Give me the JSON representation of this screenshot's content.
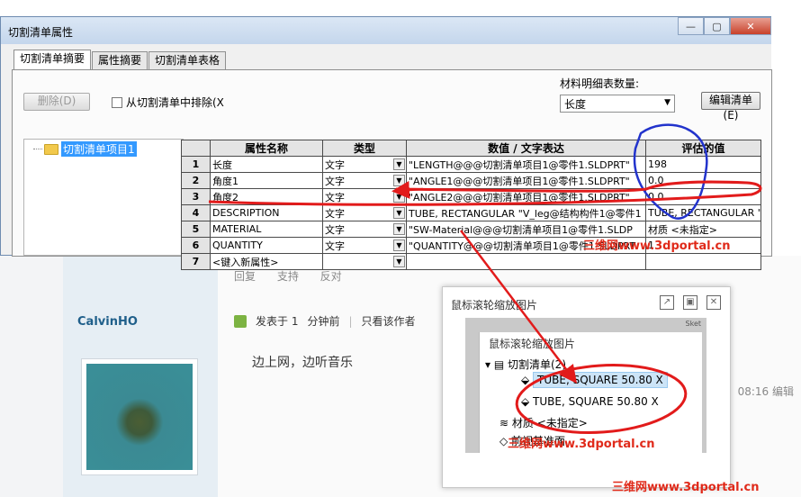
{
  "dialog": {
    "title": "切割清单属性",
    "win_minimize": "—",
    "win_maximize": "▢",
    "win_close": "✕",
    "tabs": [
      {
        "label": "切割清单摘要"
      },
      {
        "label": "属性摘要"
      },
      {
        "label": "切割清单表格"
      }
    ],
    "delete_label": "删除(D)",
    "exclude_label": "从切割清单中排除(X",
    "bom_qty_label": "材料明细表数量:",
    "bom_qty_value": "长度",
    "edit_list_label": "编辑清单(E)",
    "tree_item": "切割清单项目1",
    "table": {
      "headers": [
        "属性名称",
        "类型",
        "数值 / 文字表达",
        "评估的值"
      ],
      "rows": [
        {
          "num": "1",
          "name": "长度",
          "type": "文字",
          "expr": "\"LENGTH@@@切割清单项目1@零件1.SLDPRT\"",
          "value": "198"
        },
        {
          "num": "2",
          "name": "角度1",
          "type": "文字",
          "expr": "\"ANGLE1@@@切割清单项目1@零件1.SLDPRT\"",
          "value": "0.0"
        },
        {
          "num": "3",
          "name": "角度2",
          "type": "文字",
          "expr": "\"ANGLE2@@@切割清单项目1@零件1.SLDPRT\"",
          "value": "0.0"
        },
        {
          "num": "4",
          "name": "DESCRIPTION",
          "type": "文字",
          "expr": "TUBE, RECTANGULAR \"V_leg@结构构件1@零件1",
          "value": "TUBE, RECTANGULAR \"V"
        },
        {
          "num": "5",
          "name": "MATERIAL",
          "type": "文字",
          "expr": "\"SW-Material@@@切割清单项目1@零件1.SLDP",
          "value": "材质 <未指定>"
        },
        {
          "num": "6",
          "name": "QUANTITY",
          "type": "文字",
          "expr": "\"QUANTITY@@@切割清单项目1@零件1.SLDPRT",
          "value": "1"
        },
        {
          "num": "7",
          "name": "<键入新属性>",
          "type": "",
          "expr": "",
          "value": ""
        }
      ]
    }
  },
  "popup": {
    "title": "鼠标滚轮缩放图片",
    "inner_title": "鼠标滚轮缩放图片",
    "tree_parent": "切割清单(2)",
    "item1": "TUBE, SQUARE 50.80 X",
    "item2": "TUBE, SQUARE 50.80 X",
    "material": "材质 <未指定>",
    "front_plane": "前视基准面",
    "sketch_label": "Sket"
  },
  "forum": {
    "author": "CalvinHO",
    "actions": "回复 支持 反对",
    "posted_prefix": "发表于 1",
    "posted_time": "分钟前",
    "only_author": "只看该作者",
    "post_text": "边上网，边听音乐",
    "edit_time": "08:16 编辑"
  },
  "watermark": "三维网www.3dportal.cn",
  "colors": {
    "annotation_red": "#e21b1b",
    "annotation_blue": "#2233cc",
    "selection_blue": "#3399ff"
  }
}
